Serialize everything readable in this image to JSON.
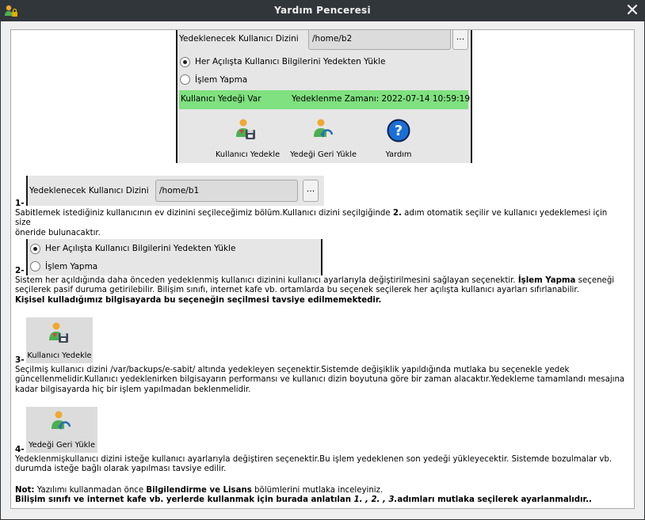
{
  "window": {
    "title": "Yardım Penceresi",
    "app_icon": "user-lock-icon",
    "close_icon": "close-icon"
  },
  "top_panel": {
    "dir_label": "Yedeklenecek Kullanıcı Dizini",
    "dir_value": "/home/b2",
    "browse_label": "...",
    "radio1_label": "Her Açılışta Kullanıcı Bilgilerini Yedekten Yükle",
    "radio2_label": "İşlem Yapma",
    "status_left": "Kullanıcı Yedeği Var",
    "status_right": "Yedeklenme Zamanı: 2022-07-14 10:59:19",
    "status_color": "#7fe17f",
    "btn_backup": "Kullanıcı Yedekle",
    "btn_restore": "Yedeği Geri Yükle",
    "btn_help": "Yardım"
  },
  "step1": {
    "num": "1-",
    "dir_label": "Yedeklenecek Kullanıcı Dizini",
    "dir_value": "/home/b1",
    "browse_label": "...",
    "text_a": "Sabitlemek istediğiniz kullanıcının ev dizinini seçileceğimiz bölüm.Kullanıcı dizini seçilgiğinde ",
    "text_bold": "2.",
    "text_b": " adım otomatik seçilir ve kullanıcı yedeklemesi için size",
    "text_c": "öneride bulunacaktır."
  },
  "step2": {
    "num": "2-",
    "radio1_label": "Her Açılışta Kullanıcı Bilgilerini Yedekten Yükle",
    "radio2_label": "İşlem Yapma",
    "text_a": "Sistem her açıldığında daha önceden yedeklenmiş kullanıcı dizinini kullanıcı ayarlarıyla değiştirilmesini sağlayan seçenektir. ",
    "text_bold": "İşlem Yapma",
    "text_b": " seçeneği",
    "text_c": "seçilerek pasif duruma getirilebilir. Bilişim sınıfı, internet kafe vb. ortamlarda bu seçenek seçilerek her açılışta kullanıcı ayarları sıfırlanabilir.",
    "text_d": "Kişisel kulladığımız bilgisayarda bu seçeneğin seçilmesi tavsiye edilmemektedir."
  },
  "step3": {
    "num": "3-",
    "btn_label": "Kullanıcı Yedekle",
    "text_a": "Seçilmiş kullanıcı dizini /var/backups/e-sabit/ altında yedekleyen seçenektir.Sistemde değişiklik yapıldığında mutlaka bu seçenekle yedek",
    "text_b": "güncellenmelidir.Kullanıcı yedeklenirken bilgisayarın performansı ve kullanıcı dizin boyutuna göre bir zaman alacaktır.Yedekleme tamamlandı mesajına",
    "text_c": "kadar bilgisayarda hiç bir işlem yapılmadan beklenmelidir."
  },
  "step4": {
    "num": "4-",
    "btn_label": "Yedeği Geri Yükle",
    "text_a": "Yedeklenmişkullanıcı dizini isteğe kullanıcı ayarlarıyla değiştiren seçenektir.Bu işlem yedeklenen son yedeği yükleyecektir. Sistemde bozulmalar vb.",
    "text_b": "durumda isteğe bağlı olarak yapılması tavsiye edilir."
  },
  "note": {
    "label": "Not:",
    "text_a": " Yazılımı kullanmadan önce ",
    "bold_a": "Bilgilendirme ve Lisans",
    "text_b": " bölümlerini mutlaka inceleyiniz.",
    "line2_a": "Bilişim sınıfı ve internet kafe vb. yerlerde kullanmak için burada anlatılan ",
    "line2_italic": "1. , 2. , 3.",
    "line2_b": "adımları mutlaka seçilerek ayarlanmalıdır.."
  }
}
